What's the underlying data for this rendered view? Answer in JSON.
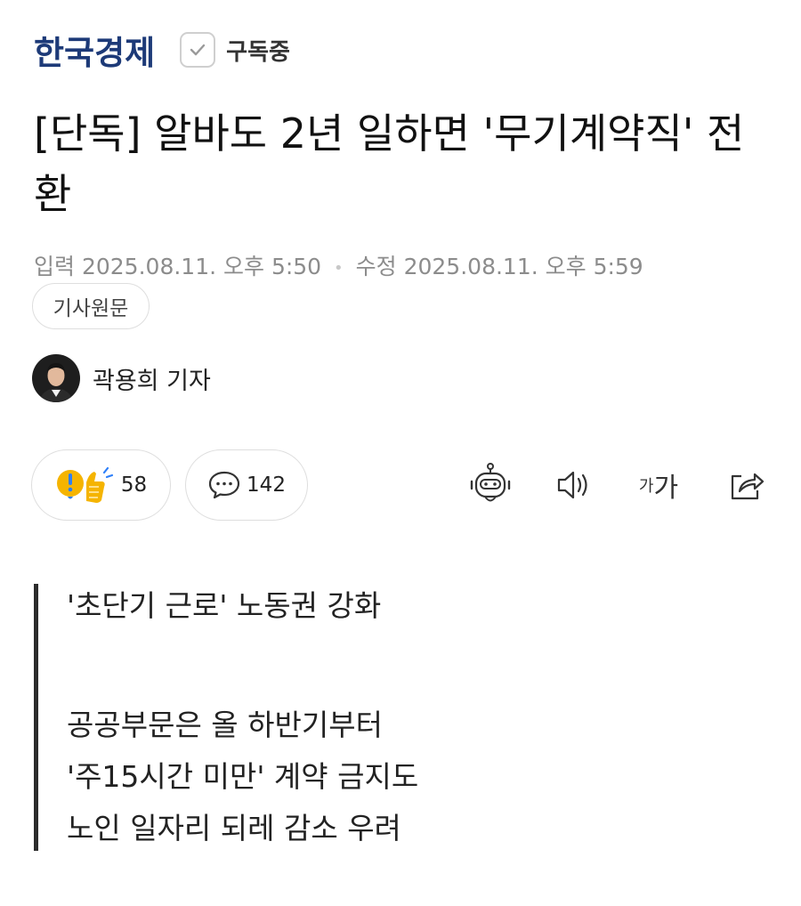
{
  "header": {
    "press_name": "한국경제",
    "subscribe_label": "구독중"
  },
  "article": {
    "title": "[단독] 알바도 2년 일하면 '무기계약직' 전환",
    "input_label": "입력",
    "input_time": "2025.08.11. 오후 5:50",
    "modified_label": "수정",
    "modified_time": "2025.08.11. 오후 5:59",
    "original_button": "기사원문",
    "reporter": "곽용희 기자"
  },
  "reactions": {
    "reaction_count": "58",
    "comment_count": "142"
  },
  "toolbar": {
    "font_small": "가",
    "font_large": "가"
  },
  "summary": {
    "line1": "'초단기 근로' 노동권 강화",
    "line2": "공공부문은 올 하반기부터",
    "line3": "'주15시간 미만' 계약 금지도",
    "line4": "노인 일자리 되레 감소 우려"
  },
  "colors": {
    "brand": "#1d3a78",
    "meta_text": "#8c8c8c",
    "border": "#dedede",
    "reaction_yellow": "#f5b400",
    "reaction_blue": "#2d7ff9"
  },
  "icons": [
    "check-icon",
    "reaction-icon",
    "comment-icon",
    "ai-bot-icon",
    "speaker-icon",
    "share-icon"
  ]
}
